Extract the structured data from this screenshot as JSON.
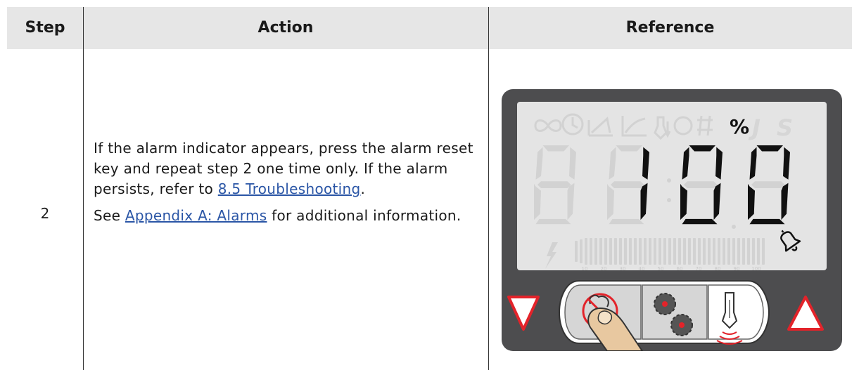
{
  "table": {
    "headers": {
      "step": "Step",
      "action": "Action",
      "reference": "Reference"
    },
    "row": {
      "step": "2",
      "action": {
        "p1_text": "If the alarm indicator appears, press the alarm reset key and repeat step 2 one time only. If the alarm persists, refer to ",
        "p1_link": "8.5 Troubleshooting",
        "p1_end": ".",
        "p2_start": "See ",
        "p2_link": "Appendix A: Alarms",
        "p2_text": " for additional information."
      }
    }
  },
  "device_display": {
    "readout": "100",
    "unit_symbol": "%",
    "dim_letters": "J S",
    "bar_scale": [
      "10",
      "20",
      "30",
      "40",
      "50",
      "60",
      "70",
      "80",
      "90",
      "100"
    ],
    "icons": [
      "infinity-icon",
      "clock-icon",
      "torque-curve-icon",
      "angle-graph-icon",
      "tool-stroke-icon",
      "circle-icon",
      "hash-icon",
      "lightning-icon",
      "bell-alarm-icon"
    ],
    "keys": [
      "down-arrow-key",
      "alarm-reset-key",
      "gears-key",
      "tool-signal-key",
      "up-arrow-key"
    ],
    "colors": {
      "panel": "#4d4d4f",
      "lcd": "#e4e4e4",
      "segment_on": "#111111",
      "segment_off": "#d2d2d2",
      "arrow_red": "#e3232a",
      "key_gray": "#d6d6d6"
    }
  }
}
